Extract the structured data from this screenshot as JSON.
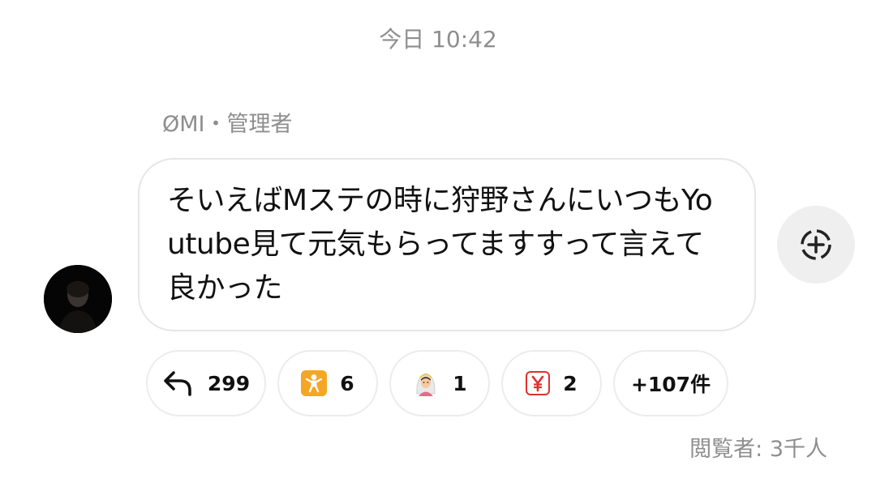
{
  "timestamp": "今日 10:42",
  "sender": {
    "name": "ØMI",
    "separator": "・",
    "role": "管理者"
  },
  "message": {
    "text": "そいえばMステの時に狩野さんにいつもYoutube見て元気もらってますすって言えて良かった"
  },
  "reactions": {
    "reply_count": "299",
    "items": [
      {
        "icon": "baby-symbol-icon",
        "glyph": "🚼",
        "count": "6"
      },
      {
        "icon": "bride-with-veil-icon",
        "glyph": "👰",
        "count": "1"
      },
      {
        "icon": "yen-sign-icon",
        "glyph": "¥",
        "count": "2"
      }
    ],
    "more_label": "+107件"
  },
  "viewers": "閲覧者: 3千人",
  "colors": {
    "muted_text": "#8e8e8e",
    "bubble_border": "#e6e6e6",
    "baby_orange": "#f5a623",
    "yen_red": "#e0312f"
  }
}
